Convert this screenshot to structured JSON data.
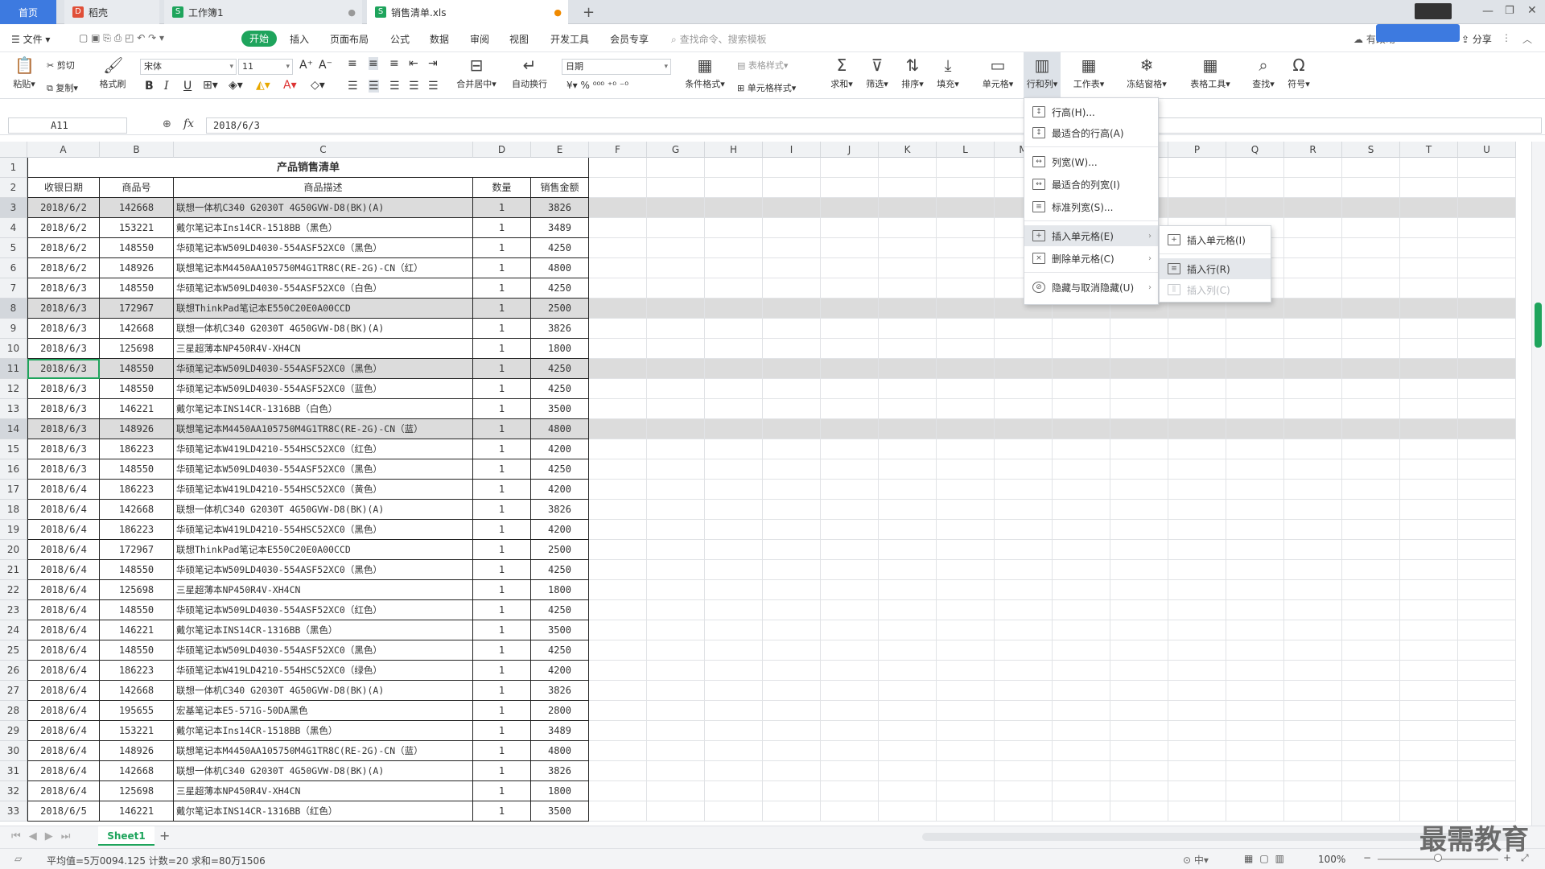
{
  "tabs": {
    "home": "首页",
    "wps": "稻壳",
    "wb1": "工作簿1",
    "current": "销售清单.xls",
    "add": "+"
  },
  "menu": {
    "file": "文件",
    "start": "开始",
    "items": [
      "插入",
      "页面布局",
      "公式",
      "数据",
      "审阅",
      "视图",
      "开发工具",
      "会员专享"
    ],
    "search": "查找命令、搜索模板",
    "share": "分享",
    "unsync": "有改动"
  },
  "ribbon": {
    "paste": "粘贴",
    "cut": "剪切",
    "copy": "复制",
    "painter": "格式刷",
    "font": "宋体",
    "size": "11",
    "merge": "合并居中",
    "wrap": "自动换行",
    "numfmt": "日期",
    "cond": "条件格式",
    "tablestyle": "表格样式",
    "cellstyle": "单元格样式",
    "sum": "求和",
    "filter": "筛选",
    "sort": "排序",
    "fill": "填充",
    "cells": "单元格",
    "rowcol": "行和列",
    "sheet": "工作表",
    "freeze": "冻结窗格",
    "tools": "表格工具",
    "find": "查找",
    "symbol": "符号"
  },
  "formula": {
    "cellref": "A11",
    "fx": "fx",
    "value": "2018/6/3"
  },
  "columns": [
    "A",
    "B",
    "C",
    "D",
    "E",
    "F",
    "G",
    "H",
    "I",
    "J",
    "K",
    "L",
    "M",
    "N",
    "O",
    "P",
    "Q",
    "R",
    "S",
    "T",
    "U"
  ],
  "sheet": {
    "title": "产品销售清单",
    "headers": [
      "收银日期",
      "商品号",
      "商品描述",
      "数量",
      "销售金额"
    ],
    "rows": [
      [
        "2018/6/2",
        "142668",
        "联想一体机C340 G2030T 4G50GVW-D8(BK)(A)",
        "1",
        "3826"
      ],
      [
        "2018/6/2",
        "153221",
        "戴尔笔记本Ins14CR-1518BB（黑色）",
        "1",
        "3489"
      ],
      [
        "2018/6/2",
        "148550",
        "华硕笔记本W509LD4030-554ASF52XC0（黑色）",
        "1",
        "4250"
      ],
      [
        "2018/6/2",
        "148926",
        "联想笔记本M4450AA105750M4G1TR8C(RE-2G)-CN（红）",
        "1",
        "4800"
      ],
      [
        "2018/6/3",
        "148550",
        "华硕笔记本W509LD4030-554ASF52XC0（白色）",
        "1",
        "4250"
      ],
      [
        "2018/6/3",
        "172967",
        "联想ThinkPad笔记本E550C20E0A00CCD",
        "1",
        "2500"
      ],
      [
        "2018/6/3",
        "142668",
        "联想一体机C340 G2030T 4G50GVW-D8(BK)(A)",
        "1",
        "3826"
      ],
      [
        "2018/6/3",
        "125698",
        "三星超薄本NP450R4V-XH4CN",
        "1",
        "1800"
      ],
      [
        "2018/6/3",
        "148550",
        "华硕笔记本W509LD4030-554ASF52XC0（黑色）",
        "1",
        "4250"
      ],
      [
        "2018/6/3",
        "148550",
        "华硕笔记本W509LD4030-554ASF52XC0（蓝色）",
        "1",
        "4250"
      ],
      [
        "2018/6/3",
        "146221",
        "戴尔笔记本INS14CR-1316BB（白色）",
        "1",
        "3500"
      ],
      [
        "2018/6/3",
        "148926",
        "联想笔记本M4450AA105750M4G1TR8C(RE-2G)-CN（蓝）",
        "1",
        "4800"
      ],
      [
        "2018/6/3",
        "186223",
        "华硕笔记本W419LD4210-554HSC52XC0（红色）",
        "1",
        "4200"
      ],
      [
        "2018/6/3",
        "148550",
        "华硕笔记本W509LD4030-554ASF52XC0（黑色）",
        "1",
        "4250"
      ],
      [
        "2018/6/4",
        "186223",
        "华硕笔记本W419LD4210-554HSC52XC0（黄色）",
        "1",
        "4200"
      ],
      [
        "2018/6/4",
        "142668",
        "联想一体机C340 G2030T 4G50GVW-D8(BK)(A)",
        "1",
        "3826"
      ],
      [
        "2018/6/4",
        "186223",
        "华硕笔记本W419LD4210-554HSC52XC0（黑色）",
        "1",
        "4200"
      ],
      [
        "2018/6/4",
        "172967",
        "联想ThinkPad笔记本E550C20E0A00CCD",
        "1",
        "2500"
      ],
      [
        "2018/6/4",
        "148550",
        "华硕笔记本W509LD4030-554ASF52XC0（黑色）",
        "1",
        "4250"
      ],
      [
        "2018/6/4",
        "125698",
        "三星超薄本NP450R4V-XH4CN",
        "1",
        "1800"
      ],
      [
        "2018/6/4",
        "148550",
        "华硕笔记本W509LD4030-554ASF52XC0（红色）",
        "1",
        "4250"
      ],
      [
        "2018/6/4",
        "146221",
        "戴尔笔记本INS14CR-1316BB（黑色）",
        "1",
        "3500"
      ],
      [
        "2018/6/4",
        "148550",
        "华硕笔记本W509LD4030-554ASF52XC0（黑色）",
        "1",
        "4250"
      ],
      [
        "2018/6/4",
        "186223",
        "华硕笔记本W419LD4210-554HSC52XC0（绿色）",
        "1",
        "4200"
      ],
      [
        "2018/6/4",
        "142668",
        "联想一体机C340 G2030T 4G50GVW-D8(BK)(A)",
        "1",
        "3826"
      ],
      [
        "2018/6/4",
        "195655",
        "宏基笔记本E5-571G-50DA黑色",
        "1",
        "2800"
      ],
      [
        "2018/6/4",
        "153221",
        "戴尔笔记本Ins14CR-1518BB（黑色）",
        "1",
        "3489"
      ],
      [
        "2018/6/4",
        "148926",
        "联想笔记本M4450AA105750M4G1TR8C(RE-2G)-CN（蓝）",
        "1",
        "4800"
      ],
      [
        "2018/6/4",
        "142668",
        "联想一体机C340 G2030T 4G50GVW-D8(BK)(A)",
        "1",
        "3826"
      ],
      [
        "2018/6/4",
        "125698",
        "三星超薄本NP450R4V-XH4CN",
        "1",
        "1800"
      ],
      [
        "2018/6/5",
        "146221",
        "戴尔笔记本INS14CR-1316BB（红色）",
        "1",
        "3500"
      ]
    ],
    "selected_rows": [
      3,
      8,
      11,
      14
    ]
  },
  "context_menu": {
    "row_height": "行高(H)...",
    "fit_row": "最适合的行高(A)",
    "col_width": "列宽(W)...",
    "fit_col": "最适合的列宽(I)",
    "std_width": "标准列宽(S)...",
    "insert_cells": "插入单元格(E)",
    "delete_cells": "删除单元格(C)",
    "hide": "隐藏与取消隐藏(U)"
  },
  "submenu": {
    "insert_cell": "插入单元格(I)",
    "insert_row": "插入行(R)",
    "insert_col": "插入列(C)"
  },
  "sheetbar": {
    "sheet1": "Sheet1",
    "add": "+"
  },
  "status": {
    "summary": "平均值=5万0094.125  计数=20  求和=80万1506",
    "zoom": "100%"
  },
  "watermark": "最需教育"
}
